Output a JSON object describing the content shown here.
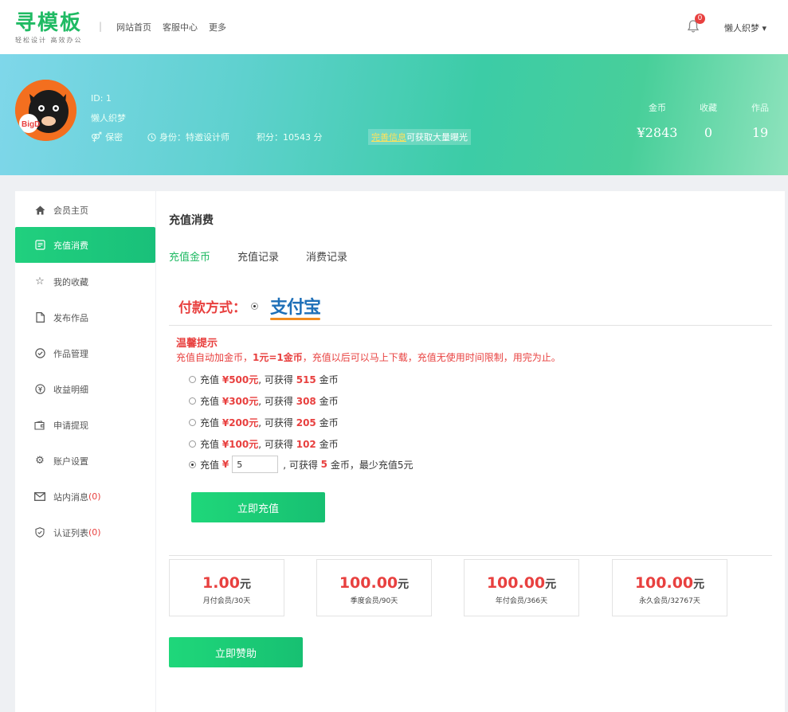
{
  "header": {
    "logo_text": "寻模板",
    "logo_slogan": "轻松设计 高效办公",
    "separator": "|",
    "nav": [
      "网站首页",
      "客服中心",
      "更多"
    ],
    "notification_count": "0",
    "user_menu_label": "懒人织梦 ▾"
  },
  "profile": {
    "id_label": "ID: 1",
    "name": "懒人织梦",
    "privacy": "保密",
    "identity": "身份：特邀设计师",
    "points": "积分：10543 分",
    "promo_link": "完善信息",
    "promo_text": "可获取大量曝光",
    "avatar_text": "BigD",
    "stats": [
      {
        "label": "金币",
        "value": "¥2843"
      },
      {
        "label": "收藏",
        "value": "0"
      },
      {
        "label": "作品",
        "value": "19"
      }
    ]
  },
  "sidebar": {
    "items": [
      {
        "label": "会员主页",
        "icon": "home-icon"
      },
      {
        "label": "充值消费",
        "icon": "recharge-icon"
      },
      {
        "label": "我的收藏",
        "icon": "star-icon"
      },
      {
        "label": "发布作品",
        "icon": "file-icon"
      },
      {
        "label": "作品管理",
        "icon": "check-circle-icon"
      },
      {
        "label": "收益明细",
        "icon": "yen-circle-icon"
      },
      {
        "label": "申请提现",
        "icon": "wallet-icon"
      },
      {
        "label": "账户设置",
        "icon": "gear-icon"
      },
      {
        "label": "站内消息",
        "icon": "mail-icon",
        "count": "(0)"
      },
      {
        "label": "认证列表",
        "icon": "shield-icon",
        "count": "(0)"
      }
    ]
  },
  "main": {
    "title": "充值消费",
    "tabs": [
      "充值金币",
      "充值记录",
      "消费记录"
    ],
    "pay_method_label": "付款方式：",
    "pay_method_logo": "支付宝",
    "tip_title": "温馨提示",
    "tip_pre": "充值自动加金币，",
    "tip_bold": "1元=1金币",
    "tip_post": "，充值以后可以马上下载，充值无使用时间限制，用完为止。",
    "options": [
      {
        "pre": "充值",
        "price": "¥500元",
        "mid": ", 可获得",
        "coins": "515",
        "post": "金币"
      },
      {
        "pre": "充值",
        "price": "¥300元",
        "mid": ", 可获得",
        "coins": "308",
        "post": "金币"
      },
      {
        "pre": "充值",
        "price": "¥200元",
        "mid": ", 可获得",
        "coins": "205",
        "post": "金币"
      },
      {
        "pre": "充值",
        "price": "¥100元",
        "mid": ", 可获得",
        "coins": "102",
        "post": "金币"
      }
    ],
    "custom_option": {
      "pre": "充值",
      "currency": "¥",
      "value": "5",
      "mid": ", 可获得",
      "coins": "5",
      "post": "金币，最少充值5元"
    },
    "recharge_button": "立即充值",
    "plans": [
      {
        "price": "1.00",
        "unit": "元",
        "desc": "月付会员/30天"
      },
      {
        "price": "100.00",
        "unit": "元",
        "desc": "季度会员/90天"
      },
      {
        "price": "100.00",
        "unit": "元",
        "desc": "年付会员/366天"
      },
      {
        "price": "100.00",
        "unit": "元",
        "desc": "永久会员/32767天"
      }
    ],
    "sponsor_button": "立即赞助"
  }
}
